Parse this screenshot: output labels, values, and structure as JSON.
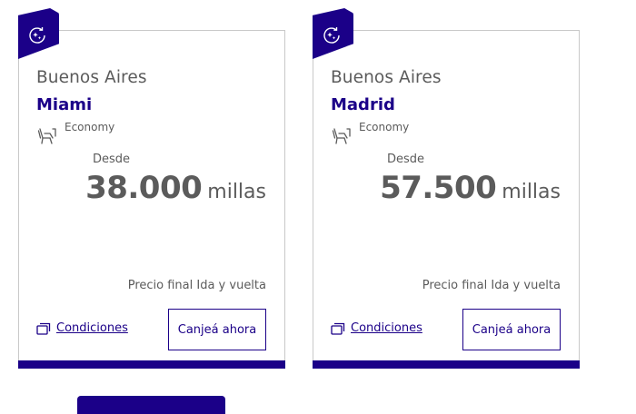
{
  "colors": {
    "brand": "#1b0088",
    "text": "#5b5b5b",
    "border": "#c9c9c9"
  },
  "cards": [
    {
      "badge_icon": "sparkle-refresh-icon",
      "origin": "Buenos Aires",
      "destination": "Miami",
      "cabin_icon": "seat-icon",
      "cabin": "Economy",
      "from_label": "Desde",
      "price": "38.000",
      "unit": "millas",
      "final_note": "Precio final Ida y vuelta",
      "conditions_icon": "copy-icon",
      "conditions": "Condiciones",
      "redeem": "Canjeá ahora"
    },
    {
      "badge_icon": "sparkle-refresh-icon",
      "origin": "Buenos Aires",
      "destination": "Madrid",
      "cabin_icon": "seat-icon",
      "cabin": "Economy",
      "from_label": "Desde",
      "price": "57.500",
      "unit": "millas",
      "final_note": "Precio final Ida y vuelta",
      "conditions_icon": "copy-icon",
      "conditions": "Condiciones",
      "redeem": "Canjeá ahora"
    }
  ]
}
